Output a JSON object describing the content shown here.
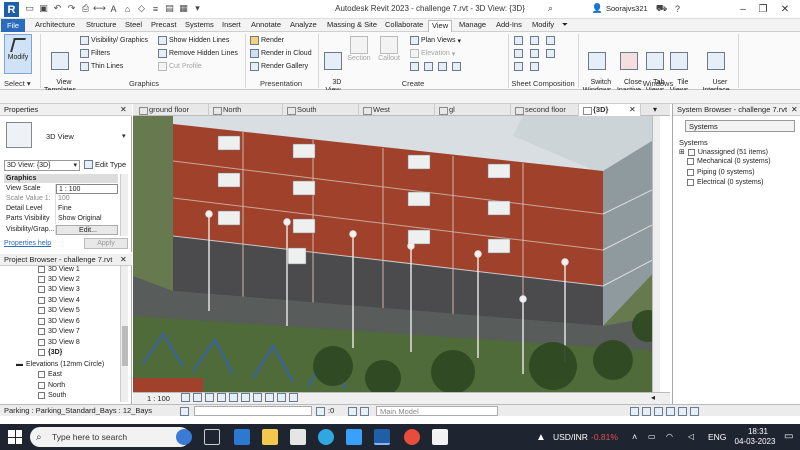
{
  "titlebar": {
    "title": "Autodesk Revit 2023 - challenge 7.rvt - 3D View: {3D}",
    "user": "Soorajvs321",
    "logo": "R"
  },
  "ribbon_tabs": [
    "File",
    "Architecture",
    "Structure",
    "Steel",
    "Precast",
    "Systems",
    "Insert",
    "Annotate",
    "Analyze",
    "Massing & Site",
    "Collaborate",
    "View",
    "Manage",
    "Add-Ins",
    "Modify"
  ],
  "active_tab": "View",
  "ribbon": {
    "modify": "Modify",
    "select": "Select ▾",
    "view_templates": "View\nTemplates",
    "visibility_graphics": "Visibility/ Graphics",
    "filters": "Filters",
    "thin_lines": "Thin Lines",
    "show_hidden_lines": "Show Hidden Lines",
    "remove_hidden_lines": "Remove Hidden Lines",
    "cut_profile": "Cut Profile",
    "graphics_label": "Graphics",
    "render": "Render",
    "render_cloud": "Render in Cloud",
    "render_gallery": "Render Gallery",
    "presentation_label": "Presentation",
    "view3d": "3D\nView",
    "section": "Section",
    "callout": "Callout",
    "plan_views": "Plan Views",
    "elevation": "Elevation",
    "create_label": "Create",
    "sheet_comp_label": "Sheet Composition",
    "switch_windows": "Switch\nWindows",
    "close_inactive": "Close\nInactive",
    "tab_views": "Tab\nViews",
    "tile_views": "Tile\nViews",
    "user_interface": "User\nInterface",
    "windows_label": "Windows"
  },
  "properties": {
    "title": "Properties",
    "type_name": "3D View",
    "view_selector": "3D View: {3D}",
    "edit_type": "Edit Type",
    "section": "Graphics",
    "rows": [
      {
        "k": "View Scale",
        "v": "1 : 100"
      },
      {
        "k": "Scale Value  1:",
        "v": "100"
      },
      {
        "k": "Detail Level",
        "v": "Fine"
      },
      {
        "k": "Parts Visibility",
        "v": "Show Original"
      },
      {
        "k": "Visibility/Grap...",
        "v": "Edit..."
      }
    ],
    "help": "Properties help",
    "apply": "Apply"
  },
  "project_browser": {
    "title": "Project Browser - challenge 7.rvt",
    "items": [
      "3D View 1",
      "3D View 2",
      "3D View 3",
      "3D View 4",
      "3D View 5",
      "3D View 6",
      "3D View 7",
      "3D View 8",
      "{3D}"
    ],
    "elevations": "Elevations (12mm Circle)",
    "elev_items": [
      "East",
      "North",
      "South"
    ]
  },
  "view_tabs": [
    "ground floor",
    "North",
    "South",
    "West",
    "gl",
    "second floor",
    "{3D}"
  ],
  "system_browser": {
    "title": "System Browser - challenge 7.rvt",
    "dropdown": "Systems",
    "header": "Systems",
    "items": [
      "Unassigned (51 items)",
      "Mechanical (0 systems)",
      "Piping (0 systems)",
      "Electrical (0 systems)"
    ]
  },
  "view_control": {
    "scale": "1 : 100"
  },
  "status": {
    "left": "Parking : Parking_Standard_Bays : 12_Bays",
    "count": ":0",
    "model": "Main Model"
  },
  "taskbar": {
    "search": "Type here to search",
    "ticker": "USD/INR",
    "change": "-0.81%",
    "lang": "ENG",
    "time": "18:31",
    "date": "04-03-2023"
  },
  "colors": {
    "accent": "#2a6bbf",
    "brick": "#a0412b",
    "grass": "#5a7a3f",
    "negative": "#e05050"
  }
}
